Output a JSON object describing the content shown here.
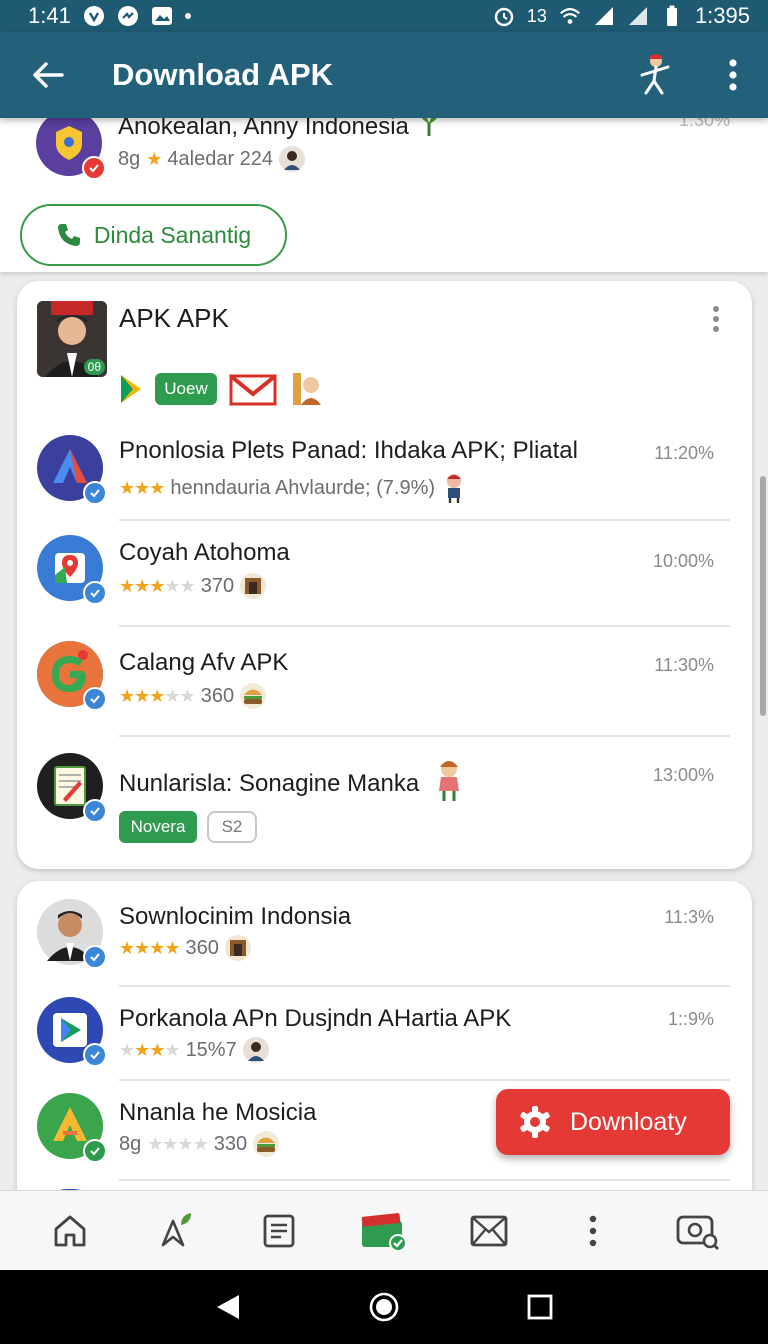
{
  "status_bar": {
    "time": "1:41",
    "right_text": "1:395",
    "signal_label": "13"
  },
  "app_bar": {
    "title": "Download APK"
  },
  "top_item": {
    "title": "Anokealan, Anny Indonesia",
    "meta_prefix": "8g",
    "meta_text": "4aledar 224",
    "time": "1:30%"
  },
  "call_button": {
    "label": "Dinda Sanantig"
  },
  "featured": {
    "title": "APK APK",
    "chip_label": "Uoew",
    "avatar_badge": "0θ"
  },
  "card1_items": [
    {
      "title": "Pnonlosia Plets Panad: Ihdaka APK; Pliatal",
      "meta": "henndauria Ahvlaurde; (7.9%)",
      "time": "11:20%",
      "stars_on": 3,
      "stars_off": 0
    },
    {
      "title": "Coyah Atohoma",
      "meta": "370",
      "time": "10:00%",
      "stars_on": 3,
      "stars_off": 2
    },
    {
      "title": "Calang Afv APK",
      "meta": "360",
      "time": "11:30%",
      "stars_on": 3,
      "stars_off": 2
    },
    {
      "title": "Nunlarisla: Sonagine Manka",
      "meta": "",
      "time": "13:00%",
      "chip_green": "Novera",
      "chip_outline": "S2"
    }
  ],
  "card2_items": [
    {
      "title": "Sownlocinim Indonsia",
      "meta": "360",
      "time": "11:3%",
      "stars_on": 4,
      "stars_off": 0
    },
    {
      "title": "Porkanola APn Dusjndn AHartia APK",
      "meta": "15%7",
      "time": "1::9%",
      "stars_on": 3,
      "stars_off": 2
    },
    {
      "title": "Nnanla he Mosicia",
      "meta_prefix": "8g",
      "meta": "330",
      "time": "",
      "stars_on": 0,
      "stars_off": 4
    }
  ],
  "fab": {
    "label": "Downloaty"
  },
  "bottom_nav": [
    "home",
    "pin-leaf",
    "document",
    "wallet-check",
    "mail",
    "more",
    "camera-search"
  ],
  "colors": {
    "appbar": "#23607a",
    "accent_green": "#2c8a3c",
    "fab_red": "#e53935",
    "star": "#f2a21b",
    "badge_blue": "#3b86d6"
  }
}
